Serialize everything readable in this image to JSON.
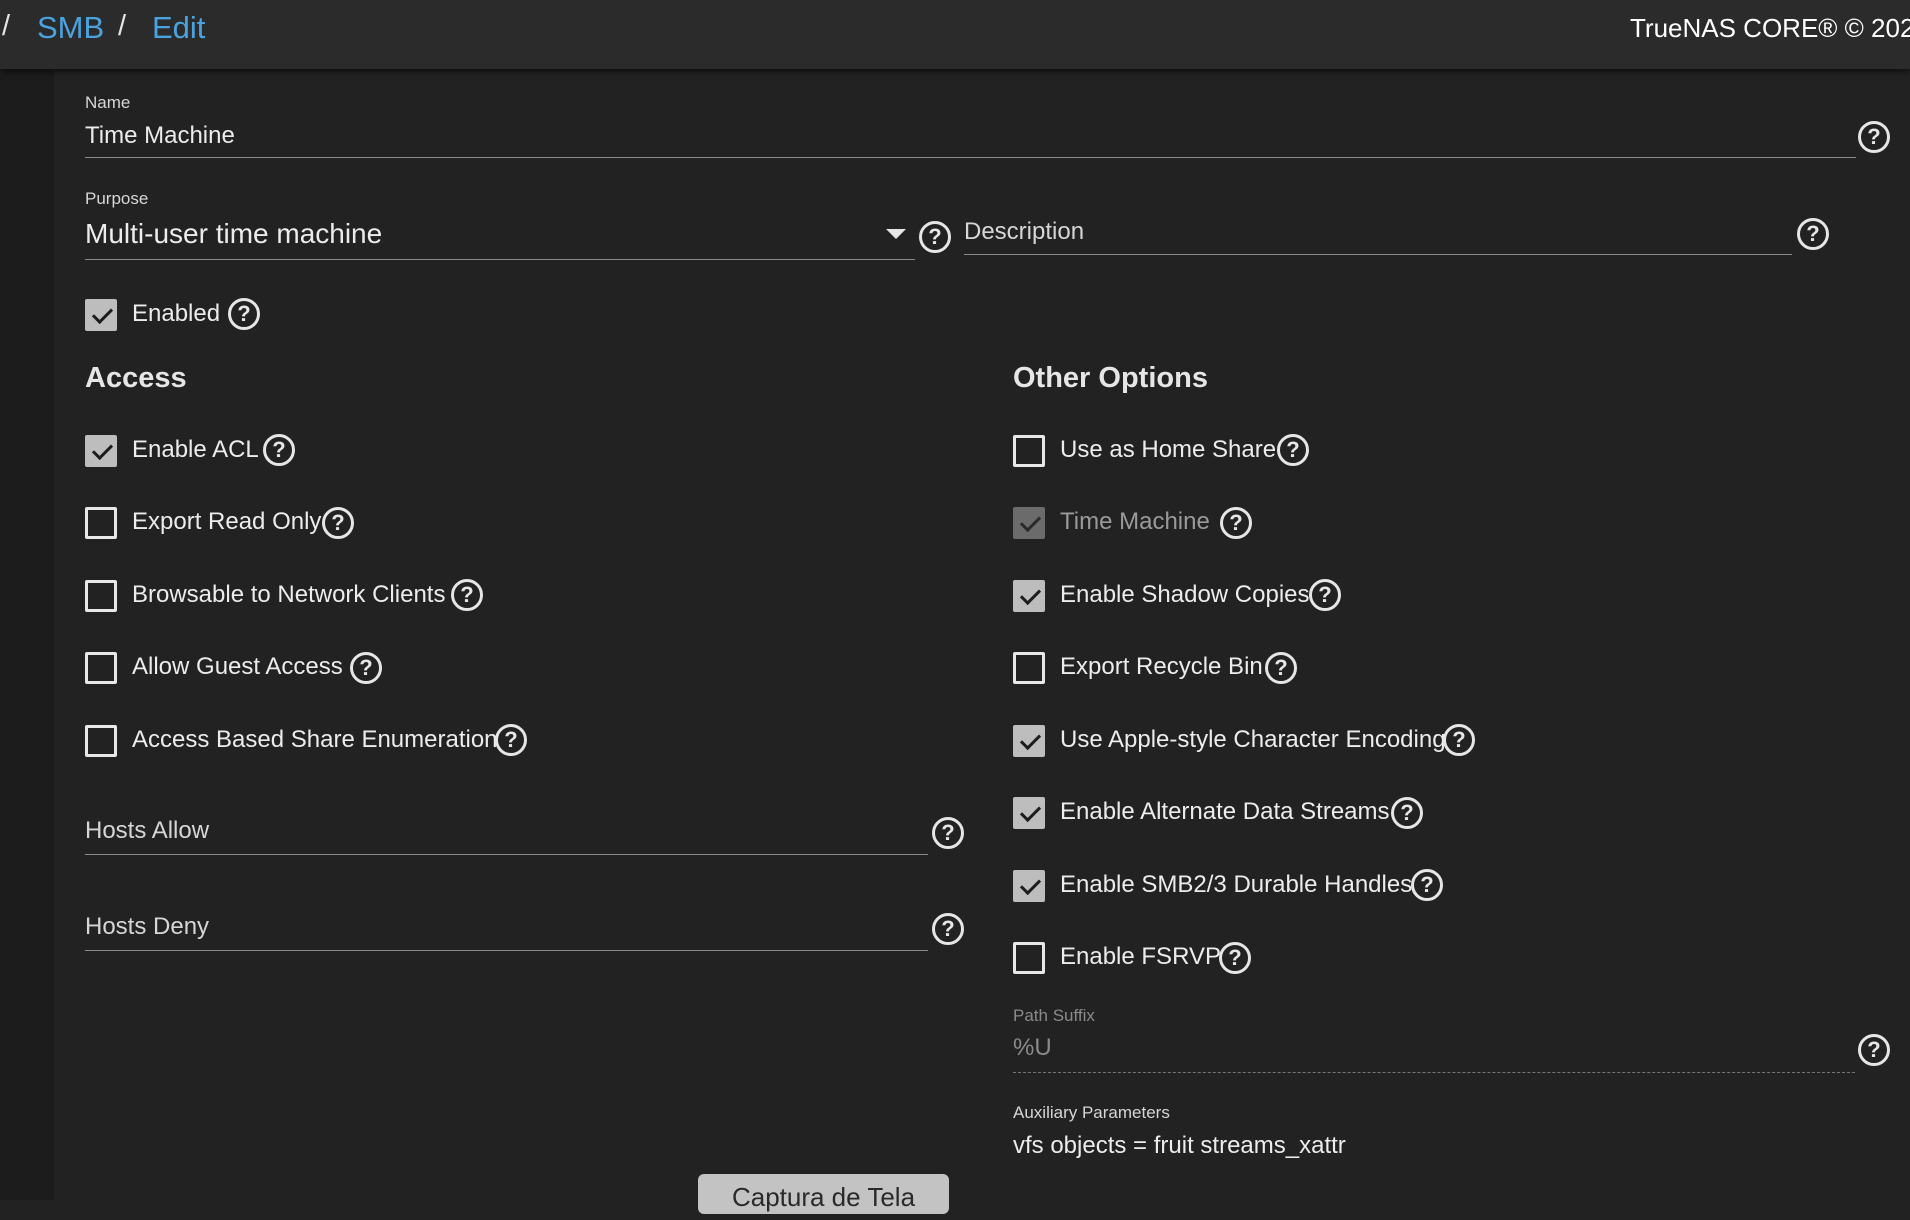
{
  "breadcrumb": {
    "root_sep": "/",
    "smb": "SMB",
    "sep": "/",
    "edit": "Edit"
  },
  "copyright": "TrueNAS CORE® © 202",
  "form": {
    "name": {
      "label": "Name",
      "value": "Time Machine"
    },
    "purpose": {
      "label": "Purpose",
      "value": "Multi-user time machine"
    },
    "description": {
      "placeholder": "Description"
    },
    "enabled": {
      "label": "Enabled",
      "checked": true
    }
  },
  "access": {
    "title": "Access",
    "options": [
      {
        "label": "Enable ACL",
        "checked": true
      },
      {
        "label": "Export Read Only",
        "checked": false
      },
      {
        "label": "Browsable to Network Clients",
        "checked": false
      },
      {
        "label": "Allow Guest Access",
        "checked": false
      },
      {
        "label": "Access Based Share Enumeration",
        "checked": false
      }
    ],
    "hosts_allow": {
      "placeholder": "Hosts Allow"
    },
    "hosts_deny": {
      "placeholder": "Hosts Deny"
    }
  },
  "other": {
    "title": "Other Options",
    "options": [
      {
        "label": "Use as Home Share",
        "checked": false,
        "disabled": false
      },
      {
        "label": "Time Machine",
        "checked": true,
        "disabled": true
      },
      {
        "label": "Enable Shadow Copies",
        "checked": true,
        "disabled": false
      },
      {
        "label": "Export Recycle Bin",
        "checked": false,
        "disabled": false
      },
      {
        "label": "Use Apple-style Character Encoding",
        "checked": true,
        "disabled": false
      },
      {
        "label": "Enable Alternate Data Streams",
        "checked": true,
        "disabled": false
      },
      {
        "label": "Enable SMB2/3 Durable Handles",
        "checked": true,
        "disabled": false
      },
      {
        "label": "Enable FSRVP",
        "checked": false,
        "disabled": false
      }
    ],
    "path_suffix": {
      "label": "Path Suffix",
      "value": "%U"
    },
    "aux_params": {
      "label": "Auxiliary Parameters",
      "value": "vfs objects = fruit streams_xattr"
    }
  },
  "help_glyph": "?",
  "overlay_button": "Captura de Tela"
}
